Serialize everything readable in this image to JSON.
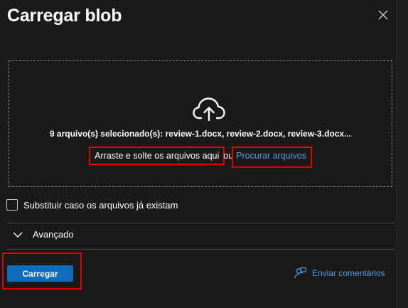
{
  "dialog": {
    "title": "Carregar blob"
  },
  "dropzone": {
    "selected_files": "9 arquivo(s) selecionado(s): review-1.docx, review-2.docx, review-3.docx...",
    "drag_text": "Arraste e solte os arquivos aqui",
    "or_text": "ou",
    "browse_link": "Procurar arquivos",
    "icon": "cloud-upload-icon"
  },
  "options": {
    "overwrite_label": "Substituir caso os arquivos já existam",
    "overwrite_checked": false,
    "advanced_label": "Avançado"
  },
  "footer": {
    "upload_label": "Carregar",
    "feedback_label": "Enviar comentários"
  },
  "colors": {
    "background": "#1b1a19",
    "accent": "#0f6cbd",
    "link": "#4f9de8",
    "highlight": "#e00000"
  }
}
